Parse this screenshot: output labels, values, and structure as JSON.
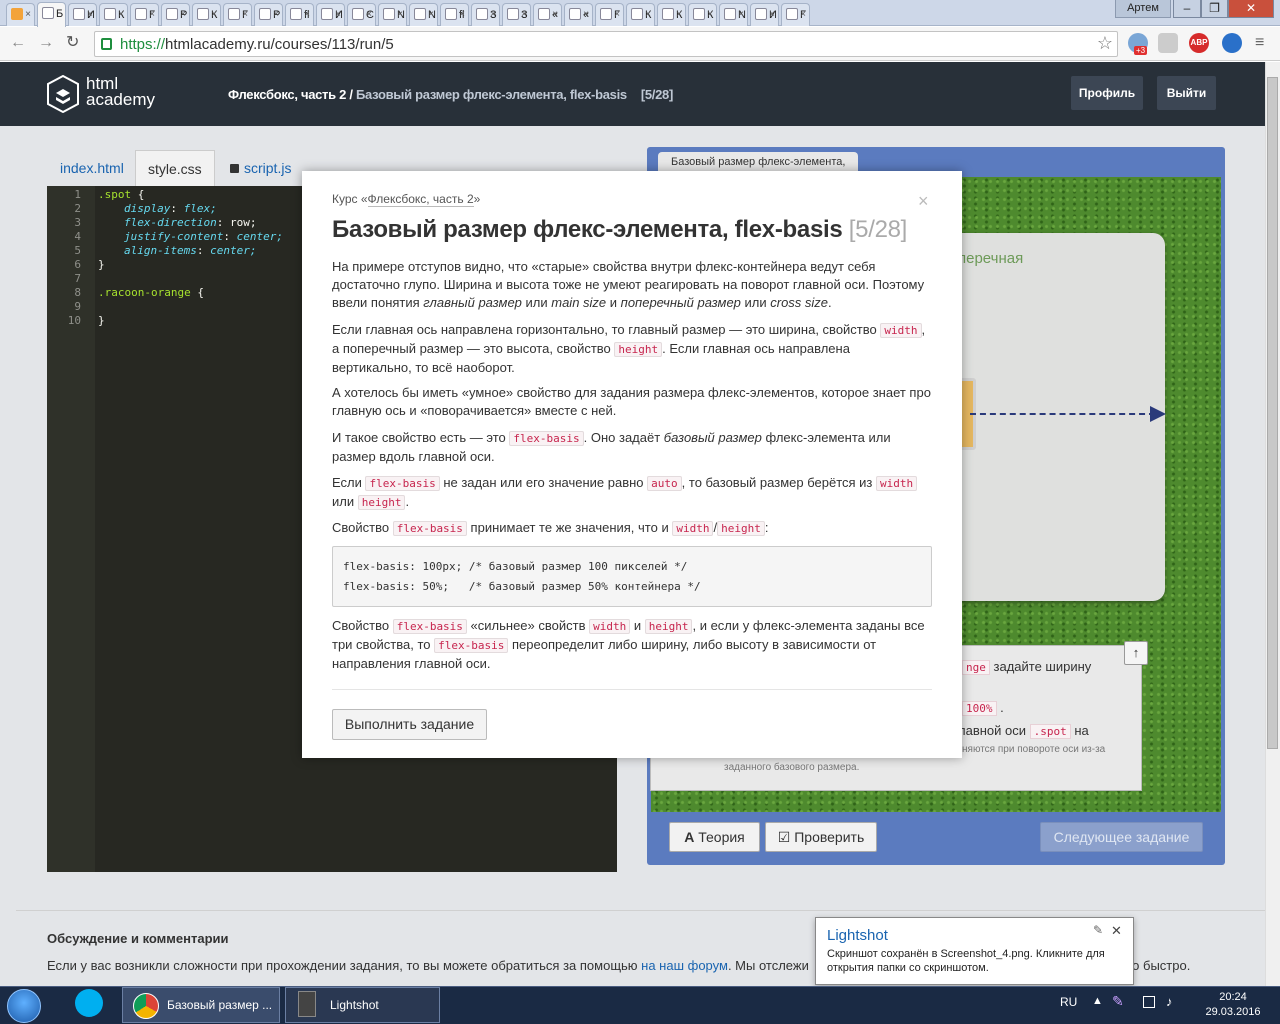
{
  "browser": {
    "tabs": [
      {
        "label": "",
        "icon": "warning-icon"
      },
      {
        "label": "Б",
        "icon": "page-icon",
        "active": true
      },
      {
        "label": "И",
        "icon": "page-icon"
      },
      {
        "label": "К",
        "icon": "page-icon"
      },
      {
        "label": "Г",
        "icon": "page-icon"
      },
      {
        "label": "Р",
        "icon": "page-icon"
      },
      {
        "label": "К",
        "icon": "page-icon"
      },
      {
        "label": "Г",
        "icon": "page-icon"
      },
      {
        "label": "Р",
        "icon": "page-icon"
      },
      {
        "label": "fl",
        "icon": "page-icon"
      },
      {
        "label": "И",
        "icon": "page-icon"
      },
      {
        "label": "С",
        "icon": "page-icon"
      },
      {
        "label": "N",
        "icon": "page-icon"
      },
      {
        "label": "N",
        "icon": "page-icon"
      },
      {
        "label": "fl",
        "icon": "page-icon"
      },
      {
        "label": "З",
        "icon": "page-icon"
      },
      {
        "label": "З",
        "icon": "page-icon"
      },
      {
        "label": "«",
        "icon": "page-icon"
      },
      {
        "label": "«",
        "icon": "page-icon"
      },
      {
        "label": "Г",
        "icon": "page-icon"
      },
      {
        "label": "К",
        "icon": "page-icon"
      },
      {
        "label": "К",
        "icon": "page-icon"
      },
      {
        "label": "К",
        "icon": "page-icon"
      },
      {
        "label": "N",
        "icon": "page-icon"
      },
      {
        "label": "И",
        "icon": "page-icon"
      },
      {
        "label": "Г",
        "icon": "page-icon"
      }
    ],
    "user": "Артем",
    "window_controls": [
      "–",
      "❐",
      "✕"
    ],
    "url_scheme": "https://",
    "url_rest": "htmlacademy.ru/courses/113/run/5",
    "ext_badge": "+3",
    "ext_abp": "ABP"
  },
  "site": {
    "logo_line1": "html",
    "logo_line2": "academy",
    "crumb_main": "Флексбокс, часть 2 /",
    "crumb_sub": "Базовый размер флекс-элемента, flex-basis",
    "crumb_count": "[5/28]",
    "profile_btn": "Профиль",
    "logout_btn": "Выйти"
  },
  "editor": {
    "tabs": [
      "index.html",
      "style.css",
      "script.js"
    ],
    "line_numbers": [
      "1",
      "2",
      "3",
      "4",
      "5",
      "6",
      "7",
      "8",
      "9",
      "10"
    ],
    "lines": [
      {
        "sel": ".spot",
        "rest": " {"
      },
      {
        "prop": "display",
        "val": "flex;"
      },
      {
        "prop": "flex-direction",
        "val": "row;"
      },
      {
        "prop": "justify-content",
        "val": "center;"
      },
      {
        "prop": "align-items",
        "val": "center;"
      },
      {
        "sel": "",
        "rest": "}"
      },
      {
        "sel": "",
        "rest": ""
      },
      {
        "sel": ".racoon-orange",
        "rest": " {"
      },
      {
        "sel": "",
        "rest": ""
      },
      {
        "sel": "",
        "rest": "}"
      }
    ]
  },
  "preview": {
    "tab_label": "Базовый размер флекс-элемента,",
    "board_label": "перечная",
    "task_line1_code": "nge",
    "task_line1": "задайте ширину",
    "task_line2_code": "100%",
    "task_line3": "лавной оси",
    "task_line3_code": ".spot",
    "task_line3b": "на",
    "task_small1": "няются при повороте оси из-за",
    "task_small2": "заданного базового размера.",
    "theory_btn": "Теория",
    "check_btn": "Проверить",
    "next_btn": "Следующее задание"
  },
  "modal": {
    "course_prefix": "Курс «",
    "course_link": "Флексбокс, часть 2",
    "course_suffix": "»",
    "title": "Базовый размер флекс-элемента, flex-basis",
    "title_count": "[5/28]",
    "p1": "На примере отступов видно, что «старые» свойства внутри флекс-контейнера ведут себя достаточно глупо. Ширина и высота тоже не умеют реагировать на поворот главной оси. Поэтому ввели понятия ",
    "p1_i1": "главный размер",
    "p1_a": " или ",
    "p1_i2": "main size",
    "p1_b": " и ",
    "p1_i3": "поперечный размер",
    "p1_c": " или ",
    "p1_i4": "cross size",
    "p1_d": ".",
    "p2_a": "Если главная ось направлена горизонтально, то главный размер — это ширина, свойство ",
    "p2_c1": "width",
    "p2_b": ", а поперечный размер — это высота, свойство ",
    "p2_c2": "height",
    "p2_c": ". Если главная ось направлена вертикально, то всё наоборот.",
    "p3": "А хотелось бы иметь «умное» свойство для задания размера флекс-элементов, которое знает про главную ось и «поворачивается» вместе с ней.",
    "p4_a": "И такое свойство есть — это ",
    "p4_c1": "flex-basis",
    "p4_b": ". Оно задаёт ",
    "p4_i": "базовый размер",
    "p4_c": " флекс-элемента или размер вдоль главной оси.",
    "p5_a": "Если ",
    "p5_c1": "flex-basis",
    "p5_b": " не задан или его значение равно ",
    "p5_c2": "auto",
    "p5_c": ", то базовый размер берётся из ",
    "p5_c3": "width",
    "p5_d": " или ",
    "p5_c4": "height",
    "p5_e": ".",
    "p6_a": "Свойство ",
    "p6_c1": "flex-basis",
    "p6_b": " принимает те же значения, что и ",
    "p6_c2": "width",
    "p6_sl": "/",
    "p6_c3": "height",
    "p6_c": ":",
    "code_line1": "flex-basis: 100px; /* базовый размер 100 пикселей */",
    "code_line2": "flex-basis: 50%;   /* базовый размер 50% контейнера */",
    "p7_a": "Свойство ",
    "p7_c1": "flex-basis",
    "p7_b": " «сильнее» свойств ",
    "p7_c2": "width",
    "p7_c": " и ",
    "p7_c3": "height",
    "p7_d": ", и если у флекс-элемента заданы все три свойства, то ",
    "p7_c4": "flex-basis",
    "p7_e": " переопределит либо ширину, либо высоту в зависимости от направления главной оси.",
    "run_btn": "Выполнить задание",
    "close": "×"
  },
  "discussion": {
    "heading": "Обсуждение и комментарии",
    "text_a": "Если у вас возникли сложности при прохождении задания, то вы можете обратиться за помощью ",
    "link": "на наш форум",
    "text_b": ". Мы отслежи",
    "text_c": "но быстро."
  },
  "lightshot": {
    "title": "Lightshot",
    "message": "Скриншот сохранён в Screenshot_4.png. Кликните для открытия папки со скриншотом.",
    "close": "✕"
  },
  "taskbar": {
    "task_chrome": "Базовый размер ...",
    "task_lightshot": "Lightshot",
    "lang": "RU",
    "time": "20:24",
    "date": "29.03.2016"
  }
}
